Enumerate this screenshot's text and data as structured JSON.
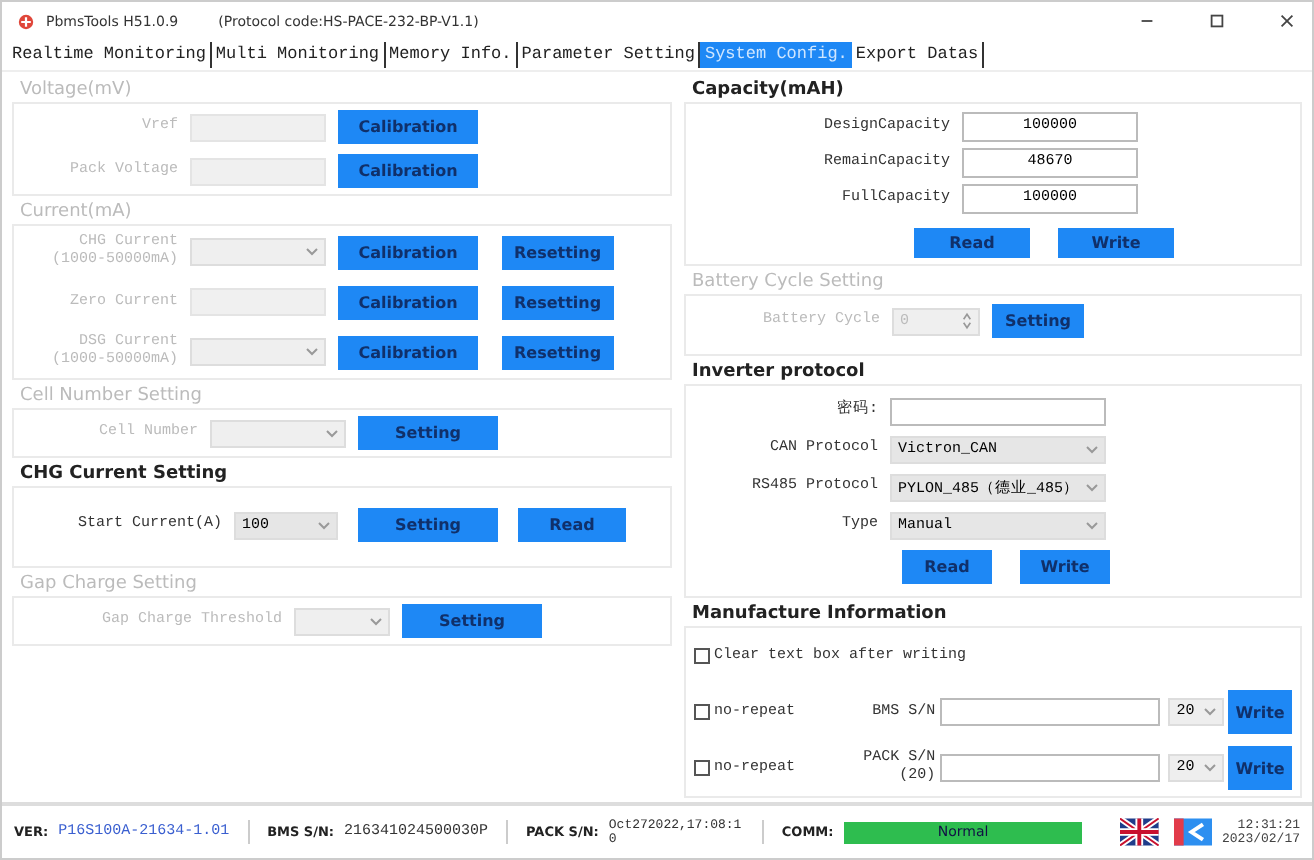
{
  "window": {
    "title": "PbmsTools H51.0.9",
    "subtitle": "(Protocol code:HS-PACE-232-BP-V1.1)"
  },
  "tabs": [
    {
      "label": "Realtime Monitoring",
      "selected": false
    },
    {
      "label": "Multi Monitoring",
      "selected": false
    },
    {
      "label": "Memory Info.",
      "selected": false
    },
    {
      "label": "Parameter Setting",
      "selected": false
    },
    {
      "label": "System Config.",
      "selected": true
    },
    {
      "label": "Export Datas",
      "selected": false
    }
  ],
  "left_sections": [
    {
      "title": "Voltage(mV)",
      "disabled": true,
      "rows": [
        {
          "kind": "field",
          "label": "Vref",
          "input": {
            "kind": "text"
          },
          "buttons": [
            "Calibration"
          ]
        },
        {
          "kind": "field",
          "label": "Pack Voltage",
          "input": {
            "kind": "text"
          },
          "buttons": [
            "Calibration"
          ]
        }
      ]
    },
    {
      "title": "Current(mA)",
      "disabled": true,
      "rows": [
        {
          "kind": "field",
          "label": "CHG Current (1000-50000mA)",
          "input": {
            "kind": "select"
          },
          "buttons": [
            "Calibration",
            "Resetting"
          ]
        },
        {
          "kind": "field",
          "label": "Zero Current",
          "input": {
            "kind": "text"
          },
          "buttons": [
            "Calibration",
            "Resetting"
          ]
        },
        {
          "kind": "field",
          "label": "DSG Current (1000-50000mA)",
          "input": {
            "kind": "select"
          },
          "buttons": [
            "Calibration",
            "Resetting"
          ]
        }
      ]
    },
    {
      "title": "Cell Number Setting",
      "disabled": true,
      "rows": [
        {
          "kind": "field",
          "label": "Cell Number",
          "input": {
            "kind": "select"
          },
          "buttons": [
            "Setting"
          ]
        }
      ]
    },
    {
      "title": "CHG Current Setting",
      "disabled": false,
      "rows": [
        {
          "kind": "field",
          "label": "Start Current(A)",
          "input": {
            "kind": "select",
            "value": "100"
          },
          "buttons": [
            "Setting",
            "Read"
          ]
        }
      ]
    },
    {
      "title": "Gap Charge Setting",
      "disabled": true,
      "rows": [
        {
          "kind": "field",
          "label": "Gap Charge Threshold",
          "input": {
            "kind": "select"
          },
          "buttons": [
            "Setting"
          ]
        }
      ]
    }
  ],
  "right_sections": [
    {
      "title": "Capacity(mAH)",
      "disabled": false,
      "rows": [
        {
          "kind": "field",
          "label": "DesignCapacity",
          "input": {
            "kind": "text",
            "value": "100000"
          }
        },
        {
          "kind": "field",
          "label": "RemainCapacity",
          "input": {
            "kind": "text",
            "value": "48670"
          }
        },
        {
          "kind": "field",
          "label": "FullCapacity",
          "input": {
            "kind": "text",
            "value": "100000"
          }
        },
        {
          "kind": "buttons",
          "buttons": [
            "Read",
            "Write"
          ]
        }
      ]
    },
    {
      "title": "Battery Cycle Setting",
      "disabled": true,
      "rows": [
        {
          "kind": "field",
          "label": "Battery Cycle",
          "input": {
            "kind": "spin",
            "value": "0"
          },
          "buttons": [
            "Setting"
          ]
        }
      ]
    },
    {
      "title": "Inverter protocol",
      "disabled": false,
      "rows": [
        {
          "kind": "field",
          "label": "密码:",
          "input": {
            "kind": "text"
          }
        },
        {
          "kind": "field",
          "label": "CAN Protocol",
          "input": {
            "kind": "select",
            "value": "Victron_CAN"
          }
        },
        {
          "kind": "field",
          "label": "RS485 Protocol",
          "input": {
            "kind": "select",
            "value": "PYLON_485（德业_485）"
          }
        },
        {
          "kind": "field",
          "label": "Type",
          "input": {
            "kind": "select",
            "value": "Manual"
          }
        },
        {
          "kind": "buttons",
          "buttons": [
            "Read",
            "Write"
          ]
        }
      ]
    },
    {
      "title": "Manufacture Information",
      "disabled": false,
      "rows": [
        {
          "kind": "check",
          "label": "Clear text box after writing",
          "checked": false
        },
        {
          "kind": "serial",
          "check": {
            "label": "no-repeat",
            "checked": false
          },
          "label": "BMS S/N",
          "input": {
            "kind": "text"
          },
          "length": "20",
          "buttons": [
            "Write"
          ]
        },
        {
          "kind": "serial",
          "check": {
            "label": "no-repeat",
            "checked": false
          },
          "label": "PACK S/N (20)",
          "input": {
            "kind": "text"
          },
          "length": "20",
          "buttons": [
            "Write"
          ]
        }
      ]
    }
  ],
  "status_bar": {
    "ver_label": "VER:",
    "ver": "P16S100A-21634-1.01",
    "bms_label": "BMS S/N:",
    "bms": "216341024500030P",
    "pack_label": "PACK S/N:",
    "pack": "Oct272022,17:08:10",
    "comm_label": "COMM:",
    "comm": "Normal",
    "time": "12:31:21",
    "date": "2023/02/17"
  }
}
